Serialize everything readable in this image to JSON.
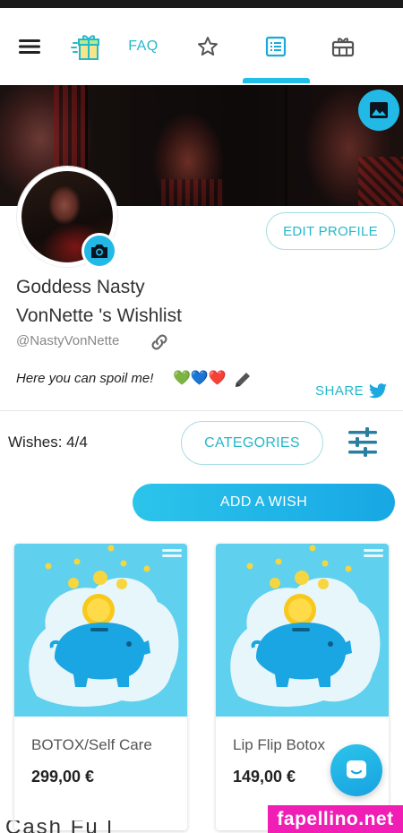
{
  "nav": {
    "faq_label": "FAQ",
    "icons": [
      "menu-icon",
      "gift-icon",
      "star-icon",
      "list-icon",
      "giftbox-icon"
    ],
    "active_tab": "list"
  },
  "profile": {
    "edit_label": "EDIT PROFILE",
    "name_line1": "Goddess Nasty",
    "name_line2": "VonNette 's Wishlist",
    "handle": "@NastyVonNette",
    "bio": "Here you can spoil me!",
    "bio_emojis": [
      "💚",
      "💙",
      "❤️"
    ],
    "share_label": "SHARE"
  },
  "wishlist": {
    "count_label": "Wishes: 4/4",
    "categories_label": "CATEGORIES",
    "add_label": "ADD A WISH",
    "items": [
      {
        "title": "BOTOX/Self Care",
        "price": "299,00 €"
      },
      {
        "title": "Lip Flip Botox",
        "price": "149,00 €"
      }
    ]
  },
  "next_section": {
    "title_fragment": "Cash Fu         l"
  },
  "watermark": "fapellino.net",
  "colors": {
    "accent": "#25b8c9",
    "button_blue": "#1eb1e6",
    "watermark": "#f01eb4",
    "card_bg": "#5fd0ed"
  }
}
